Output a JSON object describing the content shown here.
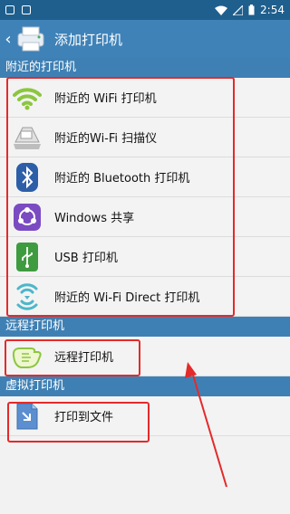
{
  "status_bar": {
    "time": "2:54"
  },
  "app_bar": {
    "title": "添加打印机"
  },
  "sections": [
    {
      "header": "附近的打印机"
    },
    {
      "header": "远程打印机"
    },
    {
      "header": "虚拟打印机"
    }
  ],
  "nearby": [
    {
      "label": "附近的 WiFi 打印机",
      "icon": "wifi-icon"
    },
    {
      "label": "附近的Wi-Fi 扫描仪",
      "icon": "scanner-icon"
    },
    {
      "label": "附近的 Bluetooth 打印机",
      "icon": "bluetooth-icon"
    },
    {
      "label": "Windows 共享",
      "icon": "windows-share-icon"
    },
    {
      "label": "USB 打印机",
      "icon": "usb-icon"
    },
    {
      "label": "附近的 Wi-Fi Direct 打印机",
      "icon": "wifi-direct-icon"
    }
  ],
  "remote": [
    {
      "label": "远程打印机",
      "icon": "remote-hand-icon"
    }
  ],
  "virtual": [
    {
      "label": "打印到文件",
      "icon": "print-to-file-icon"
    }
  ],
  "colors": {
    "status_bar": "#1f5f8e",
    "app_bar": "#3e82b8",
    "section_header": "#3f80b4",
    "highlight": "#e42a2a"
  }
}
